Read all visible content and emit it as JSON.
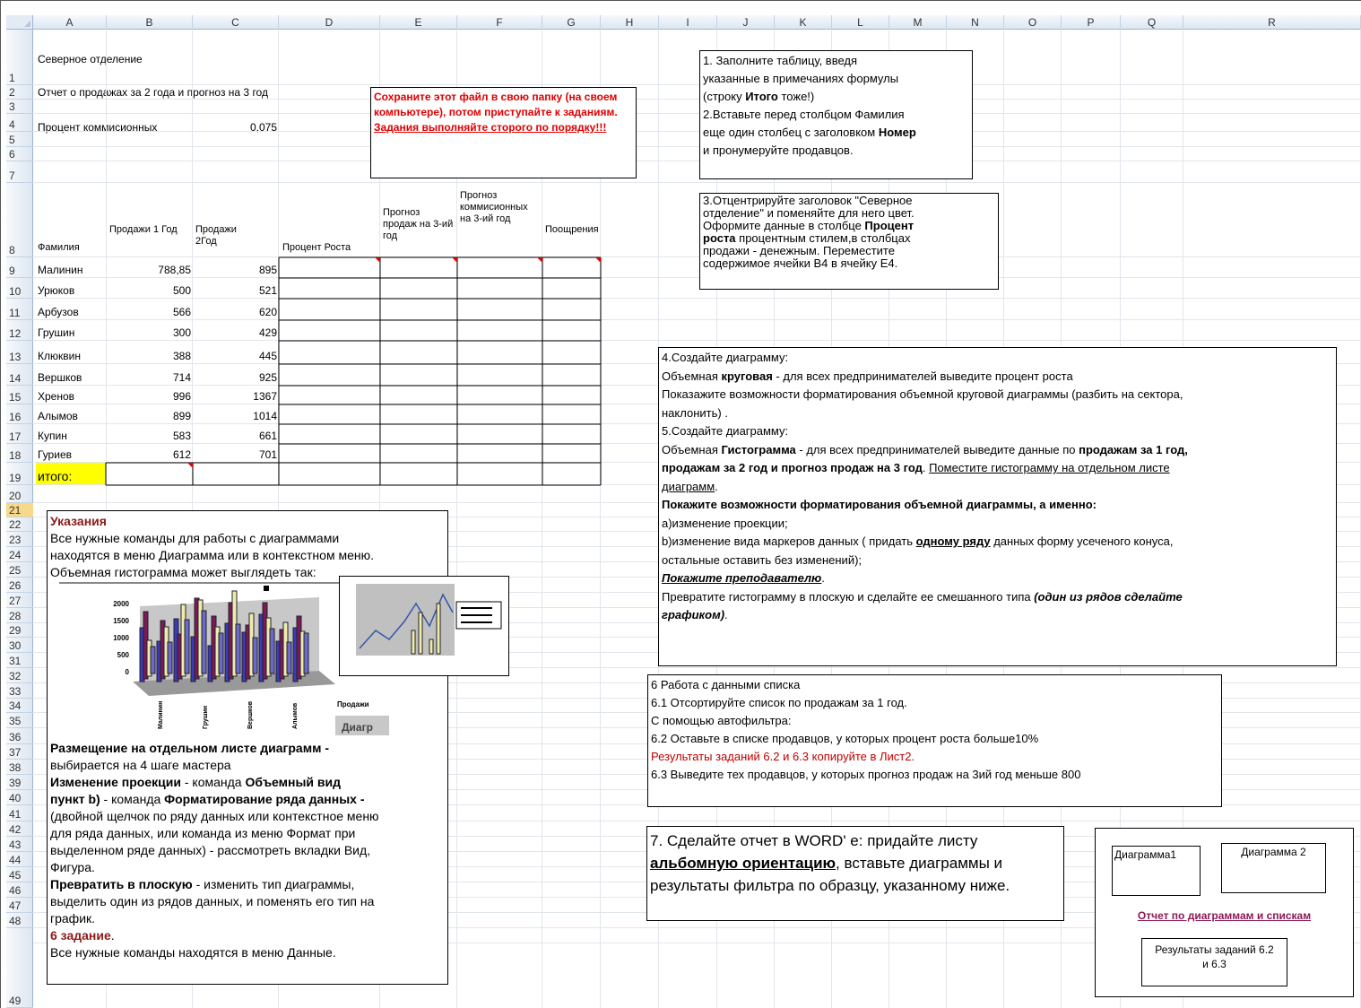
{
  "columns": [
    "A",
    "B",
    "C",
    "D",
    "E",
    "F",
    "G",
    "H",
    "I",
    "J",
    "K",
    "L",
    "M",
    "N",
    "O",
    "P",
    "Q",
    "R"
  ],
  "rows": [
    "1",
    "2",
    "3",
    "4",
    "5",
    "6",
    "7",
    "8",
    "9",
    "10",
    "11",
    "12",
    "13",
    "14",
    "15",
    "16",
    "17",
    "18",
    "19",
    "20",
    "21",
    "22",
    "23",
    "24",
    "25",
    "26",
    "27",
    "28",
    "29",
    "30",
    "31",
    "32",
    "33",
    "34",
    "35",
    "36",
    "37",
    "38",
    "39",
    "40",
    "41",
    "42",
    "43",
    "44",
    "45",
    "46",
    "47",
    "48",
    "49"
  ],
  "sheet": {
    "title": "Северное отделение",
    "subtitle": "Отчет о продажах за 2 года и прогноз на 3 год",
    "commission_label": "Процент коммисионных",
    "commission_value": "0,075",
    "headers": {
      "a": "Фамилия",
      "b": "Продажи 1 Год",
      "c": "Продажи 2Год",
      "d": "Процент Роста",
      "e": "Прогноз продаж на 3-ий год",
      "f": "Прогноз коммисионных на 3-ий год",
      "g": "Поощрения"
    },
    "data": [
      {
        "name": "Малинин",
        "s1": "788,85",
        "s2": "895"
      },
      {
        "name": "Урюков",
        "s1": "500",
        "s2": "521"
      },
      {
        "name": "Арбузов",
        "s1": "566",
        "s2": "620"
      },
      {
        "name": "Грушин",
        "s1": "300",
        "s2": "429"
      },
      {
        "name": "Клюквин",
        "s1": "388",
        "s2": "445"
      },
      {
        "name": "Вершков",
        "s1": "714",
        "s2": "925"
      },
      {
        "name": "Хренов",
        "s1": "996",
        "s2": "1367"
      },
      {
        "name": "Алымов",
        "s1": "899",
        "s2": "1014"
      },
      {
        "name": "Купин",
        "s1": "583",
        "s2": "661"
      },
      {
        "name": "Гуриев",
        "s1": "612",
        "s2": "701"
      }
    ],
    "total_label": "итого:"
  },
  "notes": {
    "save_note": [
      "Сохраните этот файл  в свою папку (на своем",
      "компьютере),  потом приступайте к заданиям.",
      "Задания выполняйте  сторого по порядку!!!"
    ],
    "task12": [
      "1. Заполните таблицу, введя",
      "указанные в примечаниях формулы",
      "(строку ",
      "Итого",
      " тоже!)",
      "2.Вставьте перед столбцом  Фамилия",
      "еще  один столбец с заголовком ",
      "Номер",
      "и пронумеруйте  продавцов."
    ],
    "task3": [
      "3.Отцентрируйте заголовок \"Северное",
      "отделение\" и поменяйте для него цвет.",
      "Оформите  данные в столбце ",
      "Процент",
      "роста",
      " процентным стилем,в столбцах",
      "продажи - денежным. Переместите",
      "содержимое ячейки В4 в ячейку Е4."
    ],
    "task45": {
      "l1": "4.Создайте диаграмму:",
      "l2a": "Объемная ",
      "l2b": "круговая",
      "l2c": " - для всех предпринимателей выведите процент роста",
      "l3": "Показажите  возможности форматирования объемной круговой диаграммы (разбить на сектора,",
      "l4": "наклонить) .",
      "l5": "5.Создайте диаграмму:",
      "l6a": "Объемная ",
      "l6b": "Гистограмма",
      "l6c": "  - для всех предпринимателей выведите данные по ",
      "l6d": "продажам за 1 год,",
      "l7a": "продажам за 2 год и прогноз продаж на 3 год",
      "l7b": ".  ",
      "l7c": "Поместите гистограмму на отдельном листе",
      "l8": "диаграмм",
      "l9": " Покажите возможности  форматирования  объемной диаграммы, а именно:",
      "l10": "a)изменение проекции;",
      "l11a": "b)изменение вида маркеров данных ( придать  ",
      "l11b": "одному  ряду",
      "l11c": " данных форму усеченого конуса,",
      "l12": "остальные оставить без изменений);",
      "l13": "Покажите преподавателю",
      "l14a": "Превратите гистограмму в плоскую и сделайте ее смешанного типа ",
      "l14b": "(один из рядов сделайте",
      "l15": "графиком)"
    },
    "task6": [
      "6  Работа с данными списка",
      "6.1 Отсортируйте  список по продажам за 1 год.",
      "С помощью автофильтра:",
      "6.2 Оставьте  в списке продавцов, у  которых процент роста больше10%",
      "Результаты заданий 6.2 и 6.3 копируйте в Лист2.",
      "6.3 Выведите тех продавцов, у которых прогноз продаж на 3ий год меньше 800"
    ],
    "task7": {
      "a": "7. Сделайте отчет в WORD' е: придайте листу",
      "b": "альбомную ориентацию",
      "c": ", вставьте диаграммы  и",
      "d": "результаты фильтра по образцу, указанному ниже."
    },
    "layout": {
      "d1": "Диаграмма1",
      "d2": "Диаграмма 2",
      "link": "Отчет по диаграммам  и спискам",
      "res": "Результаты заданий 6.2 и 6.3"
    },
    "hints": {
      "title": "Указания",
      "p1": "Все нужные команды для работы с диаграммами",
      "p2": "находятся в меню Диаграмма или в контекстном меню.",
      "p3": "Объемная гистограмма может выглядеть так:",
      "h1": "Размещение  на отдельном  листе  диаграмм",
      "h1b": " -",
      "p4": "выбирается на 4 шаге мастера",
      "h2": "Изменение  проекции",
      "h2b": " - команда ",
      "h2c": "Объемный  вид",
      "h3": "пункт b)",
      "h3b": " - команда ",
      "h3c": "Форматирование  ряда данных",
      "h3d": " -",
      "p5": "(двойной щелчок по ряду данных или контекстное меню",
      "p6": "для ряда данных, или команда из меню Формат при",
      "p7": "выделенном ряде данных) - рассмотреть вкладки Вид,",
      "p8": "Фигура.",
      "h4": "Превратить  в плоскую",
      "h4b": " - изменить тип диаграммы,",
      "p9": "выделить один из рядов данных, и поменять его тип на",
      "p10": "график.",
      "h5": "6 задание",
      "h5b": ".",
      "p11": "Все нужные команды находятся в меню Данные."
    },
    "chart_labels": {
      "y2000": "2000",
      "y1500": "1500",
      "y1000": "1000",
      "y500": "500",
      "y0": "0",
      "x1": "Малинин",
      "x2": "Грушин",
      "x3": "Вершков",
      "x4": "Алымов",
      "axis": "Продажи",
      "btn": "Диагр"
    }
  },
  "colors": {
    "yellow": "#ffff00",
    "red": "#e00000",
    "darkred": "#8b1a1a",
    "grid": "#e1e6ec"
  }
}
